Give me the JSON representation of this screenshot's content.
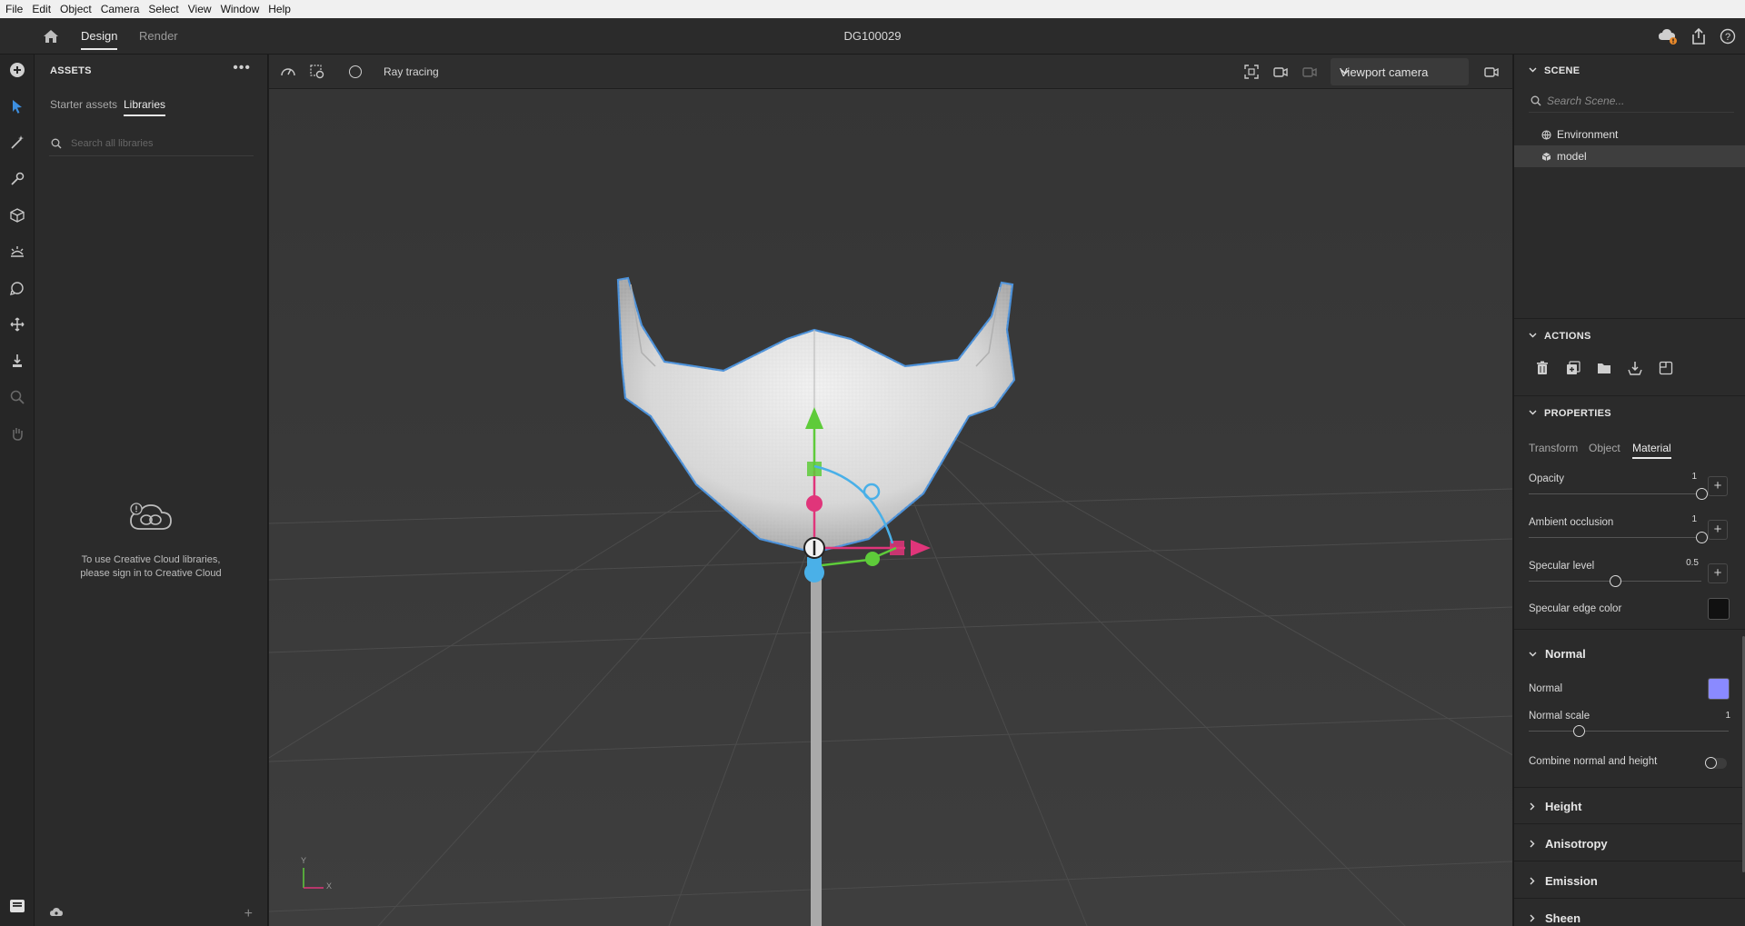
{
  "menu": [
    "File",
    "Edit",
    "Object",
    "Camera",
    "Select",
    "View",
    "Window",
    "Help"
  ],
  "titlebar": {
    "tabs": [
      "Design",
      "Render"
    ],
    "active_tab": "Design",
    "document_title": "DG100029"
  },
  "assets": {
    "title": "ASSETS",
    "tabs": [
      "Starter assets",
      "Libraries"
    ],
    "active_tab": "Libraries",
    "search_placeholder": "Search all libraries",
    "empty_message_line1": "To use Creative Cloud libraries,",
    "empty_message_line2": "please sign in to Creative Cloud"
  },
  "viewport": {
    "ray_tracing_label": "Ray tracing",
    "ray_tracing_enabled": false,
    "camera": "Viewport camera",
    "axis_labels": {
      "x": "X",
      "y": "Y"
    }
  },
  "scene": {
    "title": "SCENE",
    "search_placeholder": "Search Scene...",
    "items": [
      {
        "label": "Environment",
        "icon": "globe-icon",
        "selected": false
      },
      {
        "label": "model",
        "icon": "cube-icon",
        "selected": true
      }
    ]
  },
  "actions": {
    "title": "ACTIONS",
    "icons": [
      "trash-icon",
      "duplicate-icon",
      "group-folder-icon",
      "export-icon",
      "package-icon"
    ]
  },
  "properties": {
    "title": "PROPERTIES",
    "tabs": [
      "Transform",
      "Object",
      "Material"
    ],
    "active_tab": "Material",
    "opacity": {
      "label": "Opacity",
      "value": "1",
      "fraction": 1.0
    },
    "ambient_occlusion": {
      "label": "Ambient occlusion",
      "value": "1",
      "fraction": 1.0
    },
    "specular_level": {
      "label": "Specular level",
      "value": "0.5",
      "fraction": 0.5
    },
    "specular_edge_color": {
      "label": "Specular edge color",
      "color": "#111111"
    },
    "normal_section": {
      "title": "Normal",
      "normal_label": "Normal",
      "normal_color": "#8a8aff",
      "normal_scale": {
        "label": "Normal scale",
        "value": "1",
        "fraction": 0.25
      },
      "combine_label": "Combine normal and height",
      "combine_enabled": false
    },
    "collapsed_sections": [
      "Height",
      "Anisotropy",
      "Emission",
      "Sheen"
    ]
  },
  "colors": {
    "accent_blue": "#4a90d9",
    "gizmo_y": "#5ecb3a",
    "gizmo_x": "#e0357a",
    "gizmo_z": "#4ab0e8"
  }
}
